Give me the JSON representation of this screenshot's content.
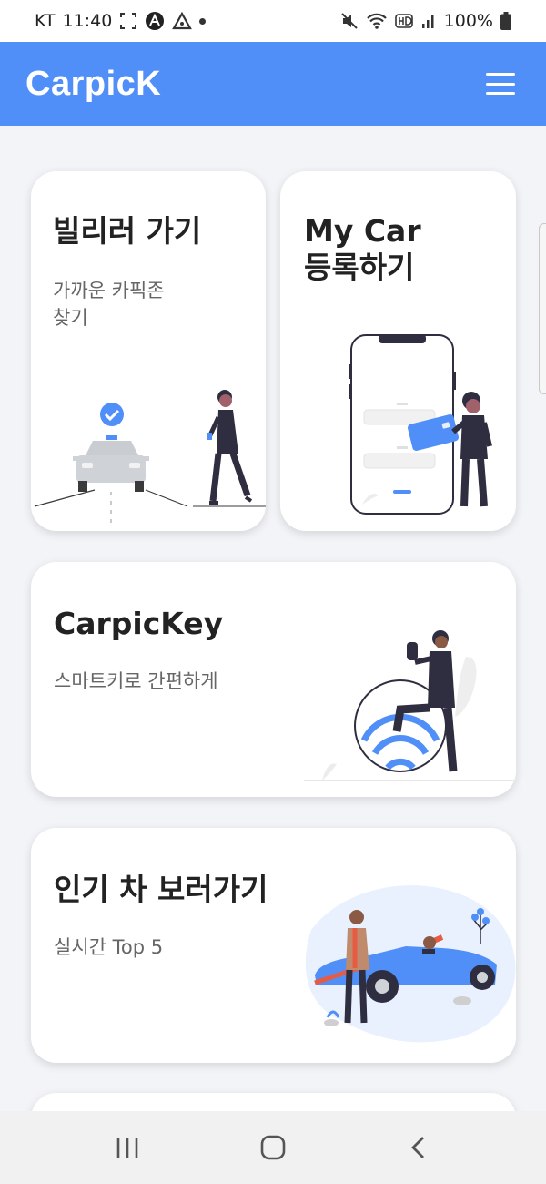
{
  "status_bar": {
    "carrier": "KT",
    "time": "11:40",
    "battery": "100%",
    "icons": [
      "screenshot-icon",
      "app-a-icon",
      "app-triangle-icon",
      "notification-dot-icon",
      "mute-icon",
      "wifi-icon",
      "hd-icon",
      "signal-icon",
      "battery-icon"
    ]
  },
  "header": {
    "title": "CarpicK",
    "menu_icon": "hamburger-menu-icon",
    "color": "#4f8ff7"
  },
  "cards": {
    "billira": {
      "title": "빌리러 가기",
      "subtitle": "가까운 카픽존\n찾기"
    },
    "mycar": {
      "title": "My Car\n등록하기"
    },
    "carpickey": {
      "title": "CarpicKey",
      "subtitle": "스마트키로 간편하게"
    },
    "popular": {
      "title": "인기 차 보러가기",
      "subtitle": "실시간 Top 5"
    }
  },
  "nav_bar": {
    "buttons": [
      "recent-apps-icon",
      "home-icon",
      "back-icon"
    ]
  },
  "colors": {
    "accent": "#4f8ff7",
    "dark_figure": "#2f2e41",
    "car_gray": "#cfd2d6",
    "card_bg": "#ffffff",
    "page_bg": "#f2f4f8"
  }
}
